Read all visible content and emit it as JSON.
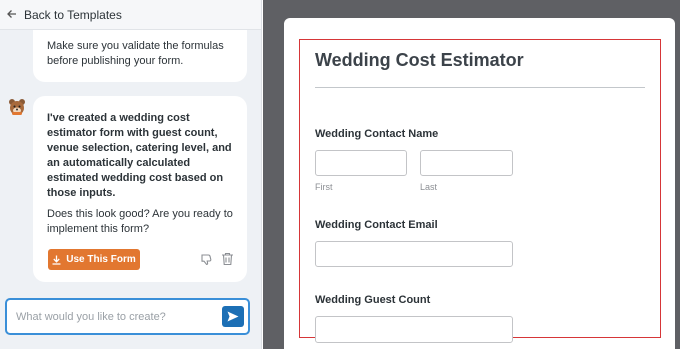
{
  "sidebar": {
    "back_label": "Back to Templates",
    "message1": "Make sure you validate the formulas before publishing your form.",
    "message2_bold": "I've created a wedding cost estimator form with guest count, venue selection, catering level, and an automatically calculated estimated wedding cost based on those inputs.",
    "message2_plain": "Does this look good? Are you ready to implement this form?",
    "use_button_label": "Use This Form",
    "prompt_placeholder": "What would you like to create?"
  },
  "form": {
    "title": "Wedding Cost Estimator",
    "contact_name_label": "Wedding Contact Name",
    "first_sublabel": "First",
    "last_sublabel": "Last",
    "contact_email_label": "Wedding Contact Email",
    "guest_count_label": "Wedding Guest Count"
  },
  "colors": {
    "accent_orange": "#e27730",
    "send_blue": "#1c6fb5",
    "focus_border": "#3a8fd8",
    "form_outline": "#d63638"
  }
}
